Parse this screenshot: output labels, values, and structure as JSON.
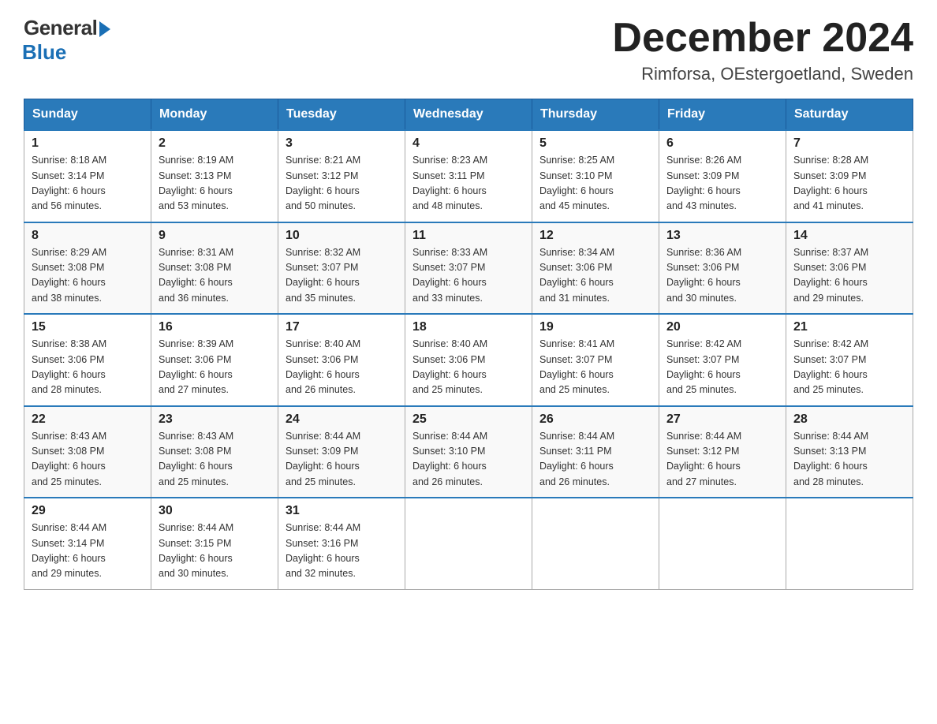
{
  "header": {
    "logo_general": "General",
    "logo_blue": "Blue",
    "month_year": "December 2024",
    "location": "Rimforsa, OEstergoetland, Sweden"
  },
  "weekdays": [
    "Sunday",
    "Monday",
    "Tuesday",
    "Wednesday",
    "Thursday",
    "Friday",
    "Saturday"
  ],
  "weeks": [
    [
      {
        "day": "1",
        "sunrise": "8:18 AM",
        "sunset": "3:14 PM",
        "daylight": "6 hours and 56 minutes."
      },
      {
        "day": "2",
        "sunrise": "8:19 AM",
        "sunset": "3:13 PM",
        "daylight": "6 hours and 53 minutes."
      },
      {
        "day": "3",
        "sunrise": "8:21 AM",
        "sunset": "3:12 PM",
        "daylight": "6 hours and 50 minutes."
      },
      {
        "day": "4",
        "sunrise": "8:23 AM",
        "sunset": "3:11 PM",
        "daylight": "6 hours and 48 minutes."
      },
      {
        "day": "5",
        "sunrise": "8:25 AM",
        "sunset": "3:10 PM",
        "daylight": "6 hours and 45 minutes."
      },
      {
        "day": "6",
        "sunrise": "8:26 AM",
        "sunset": "3:09 PM",
        "daylight": "6 hours and 43 minutes."
      },
      {
        "day": "7",
        "sunrise": "8:28 AM",
        "sunset": "3:09 PM",
        "daylight": "6 hours and 41 minutes."
      }
    ],
    [
      {
        "day": "8",
        "sunrise": "8:29 AM",
        "sunset": "3:08 PM",
        "daylight": "6 hours and 38 minutes."
      },
      {
        "day": "9",
        "sunrise": "8:31 AM",
        "sunset": "3:08 PM",
        "daylight": "6 hours and 36 minutes."
      },
      {
        "day": "10",
        "sunrise": "8:32 AM",
        "sunset": "3:07 PM",
        "daylight": "6 hours and 35 minutes."
      },
      {
        "day": "11",
        "sunrise": "8:33 AM",
        "sunset": "3:07 PM",
        "daylight": "6 hours and 33 minutes."
      },
      {
        "day": "12",
        "sunrise": "8:34 AM",
        "sunset": "3:06 PM",
        "daylight": "6 hours and 31 minutes."
      },
      {
        "day": "13",
        "sunrise": "8:36 AM",
        "sunset": "3:06 PM",
        "daylight": "6 hours and 30 minutes."
      },
      {
        "day": "14",
        "sunrise": "8:37 AM",
        "sunset": "3:06 PM",
        "daylight": "6 hours and 29 minutes."
      }
    ],
    [
      {
        "day": "15",
        "sunrise": "8:38 AM",
        "sunset": "3:06 PM",
        "daylight": "6 hours and 28 minutes."
      },
      {
        "day": "16",
        "sunrise": "8:39 AM",
        "sunset": "3:06 PM",
        "daylight": "6 hours and 27 minutes."
      },
      {
        "day": "17",
        "sunrise": "8:40 AM",
        "sunset": "3:06 PM",
        "daylight": "6 hours and 26 minutes."
      },
      {
        "day": "18",
        "sunrise": "8:40 AM",
        "sunset": "3:06 PM",
        "daylight": "6 hours and 25 minutes."
      },
      {
        "day": "19",
        "sunrise": "8:41 AM",
        "sunset": "3:07 PM",
        "daylight": "6 hours and 25 minutes."
      },
      {
        "day": "20",
        "sunrise": "8:42 AM",
        "sunset": "3:07 PM",
        "daylight": "6 hours and 25 minutes."
      },
      {
        "day": "21",
        "sunrise": "8:42 AM",
        "sunset": "3:07 PM",
        "daylight": "6 hours and 25 minutes."
      }
    ],
    [
      {
        "day": "22",
        "sunrise": "8:43 AM",
        "sunset": "3:08 PM",
        "daylight": "6 hours and 25 minutes."
      },
      {
        "day": "23",
        "sunrise": "8:43 AM",
        "sunset": "3:08 PM",
        "daylight": "6 hours and 25 minutes."
      },
      {
        "day": "24",
        "sunrise": "8:44 AM",
        "sunset": "3:09 PM",
        "daylight": "6 hours and 25 minutes."
      },
      {
        "day": "25",
        "sunrise": "8:44 AM",
        "sunset": "3:10 PM",
        "daylight": "6 hours and 26 minutes."
      },
      {
        "day": "26",
        "sunrise": "8:44 AM",
        "sunset": "3:11 PM",
        "daylight": "6 hours and 26 minutes."
      },
      {
        "day": "27",
        "sunrise": "8:44 AM",
        "sunset": "3:12 PM",
        "daylight": "6 hours and 27 minutes."
      },
      {
        "day": "28",
        "sunrise": "8:44 AM",
        "sunset": "3:13 PM",
        "daylight": "6 hours and 28 minutes."
      }
    ],
    [
      {
        "day": "29",
        "sunrise": "8:44 AM",
        "sunset": "3:14 PM",
        "daylight": "6 hours and 29 minutes."
      },
      {
        "day": "30",
        "sunrise": "8:44 AM",
        "sunset": "3:15 PM",
        "daylight": "6 hours and 30 minutes."
      },
      {
        "day": "31",
        "sunrise": "8:44 AM",
        "sunset": "3:16 PM",
        "daylight": "6 hours and 32 minutes."
      },
      null,
      null,
      null,
      null
    ]
  ],
  "labels": {
    "sunrise": "Sunrise:",
    "sunset": "Sunset:",
    "daylight": "Daylight:"
  }
}
